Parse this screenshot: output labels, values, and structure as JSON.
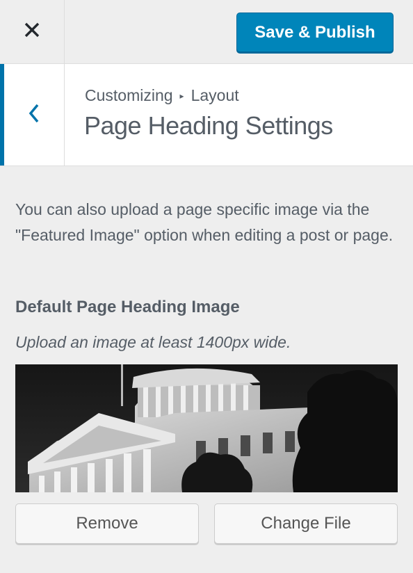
{
  "header": {
    "close_icon": "close-icon",
    "publish_label": "Save & Publish",
    "publish_color": "#0085ba"
  },
  "section": {
    "back_icon": "chevron-left-icon",
    "breadcrumb": [
      "Customizing",
      "Layout"
    ],
    "breadcrumb_separator_icon": "triangle-right-icon",
    "title": "Page Heading Settings",
    "accent_color": "#0073aa"
  },
  "content": {
    "description": "You can also upload a page specific image via the \"Featured Image\" option when editing a post or page.",
    "control_title": "Default Page Heading Image",
    "control_note": "Upload an image at least 1400px wide.",
    "preview_image": "grayscale photo of a domed capitol building with trees",
    "remove_label": "Remove",
    "change_label": "Change File"
  }
}
